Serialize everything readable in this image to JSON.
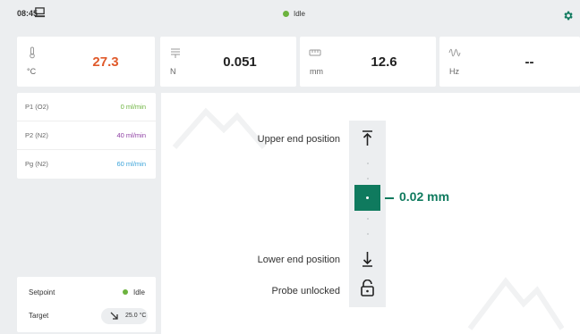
{
  "topbar": {
    "time": "08:45",
    "status_label": "Idle",
    "status_color": "#6cb33e",
    "icons": [
      "pc-icon",
      "settings-gear-icon"
    ]
  },
  "tiles": [
    {
      "icon": "thermometer-icon",
      "unit": "°C",
      "value": "27.3",
      "value_color": "#e05a2b"
    },
    {
      "icon": "force-icon",
      "unit": "N",
      "value": "0.051"
    },
    {
      "icon": "length-icon",
      "unit": "mm",
      "value": "12.6"
    },
    {
      "icon": "frequency-icon",
      "unit": "Hz",
      "value": "--"
    }
  ],
  "gases": [
    {
      "name": "P1 (O2)",
      "flow": "0 ml/min",
      "color": "#6cb33e"
    },
    {
      "name": "P2 (N2)",
      "flow": "40 ml/min",
      "color": "#8e3fa3"
    },
    {
      "name": "Pg (N2)",
      "flow": "60 ml/min",
      "color": "#3aa3d9"
    }
  ],
  "setpoint": {
    "label": "Setpoint",
    "state": "Idle",
    "target_label": "Target",
    "target_value": "25.0 °C"
  },
  "probe": {
    "upper_label": "Upper end position",
    "lower_label": "Lower end position",
    "lock_label": "Probe unlocked",
    "reading": "0.02 mm",
    "accent": "#0f7a5e"
  }
}
